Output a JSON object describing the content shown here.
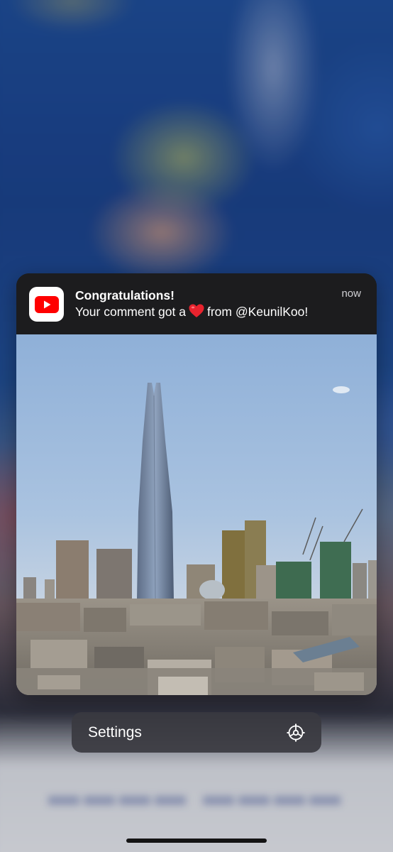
{
  "notification": {
    "app_icon": "youtube-icon",
    "title": "Congratulations!",
    "body_prefix": "Your comment got a",
    "body_emoji": "heart-emoji",
    "body_suffix": "from @KeunilKoo!",
    "time": "now",
    "image": "city-skyline-photo"
  },
  "context_menu": {
    "settings_label": "Settings",
    "settings_icon": "gear-icon"
  },
  "colors": {
    "card_background": "#1c1c1e",
    "menu_background": "#3a3a40",
    "youtube_red": "#ff0000",
    "heart_red": "#e8232e"
  }
}
